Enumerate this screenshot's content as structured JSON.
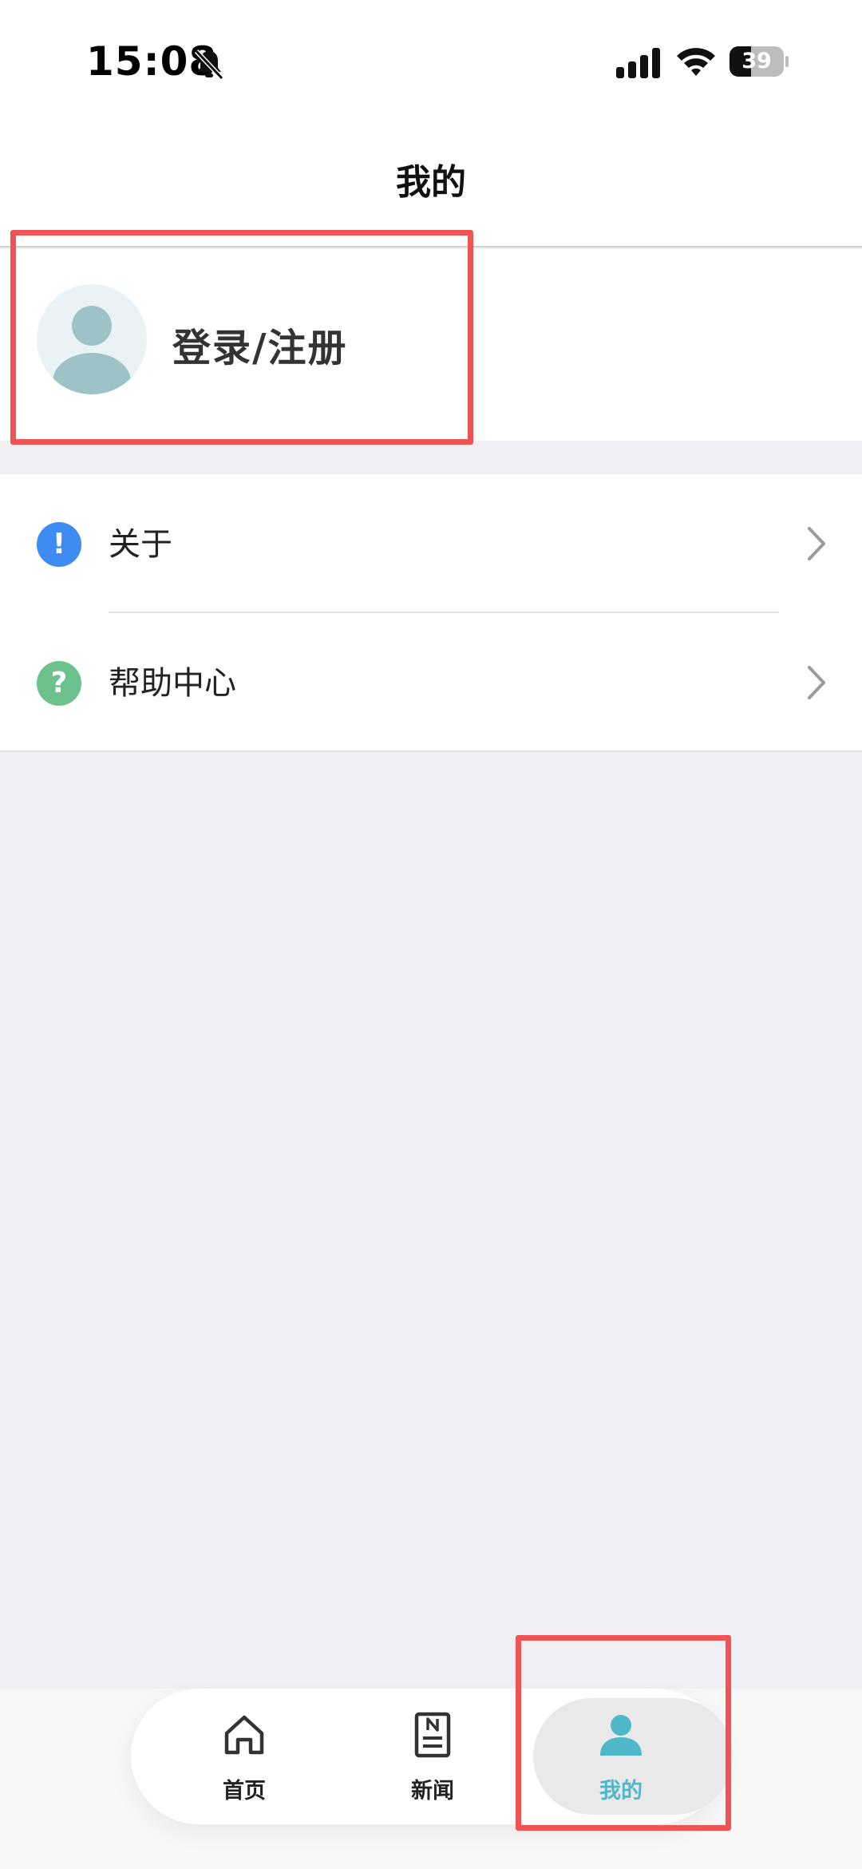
{
  "status_bar": {
    "time": "15:08",
    "battery_level": "39",
    "battery_fraction": 0.39,
    "icons": [
      "bell-muted-icon",
      "cellular-signal-icon",
      "wifi-icon",
      "battery-icon"
    ]
  },
  "nav": {
    "title": "我的"
  },
  "profile": {
    "label": "登录/注册",
    "avatar_icon": "person-icon"
  },
  "menu": {
    "items": [
      {
        "label": "关于",
        "icon": "info-icon",
        "icon_glyph": "!",
        "icon_color": "#3e8bf1"
      },
      {
        "label": "帮助中心",
        "icon": "question-icon",
        "icon_glyph": "?",
        "icon_color": "#6cc18d"
      }
    ]
  },
  "tabbar": {
    "tabs": [
      {
        "label": "首页",
        "icon": "home-icon",
        "active": false
      },
      {
        "label": "新闻",
        "icon": "news-icon",
        "active": false
      },
      {
        "label": "我的",
        "icon": "person-icon",
        "active": true
      }
    ]
  },
  "colors": {
    "accent": "#4fb8c8",
    "highlight_border": "#ef5455",
    "page_background": "#f0eff4"
  }
}
